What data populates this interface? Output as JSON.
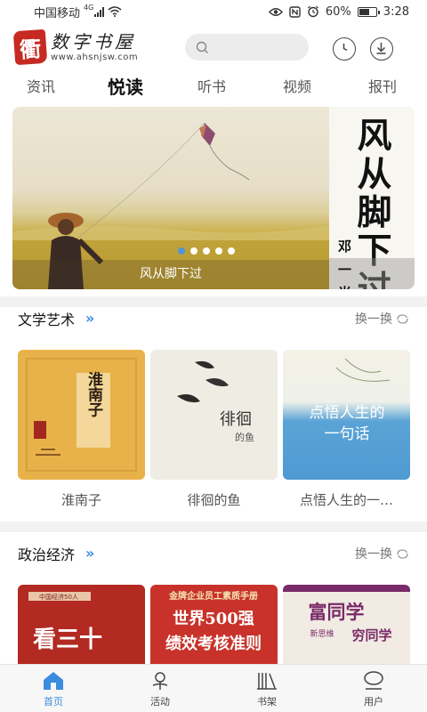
{
  "status_bar": {
    "carrier": "中国移动",
    "network": "4G",
    "battery_percent": "60%",
    "battery_level": 0.6,
    "time": "3:28",
    "icons": [
      "signal-icon",
      "wifi-icon",
      "eye-icon",
      "nfc-icon",
      "alarm-icon",
      "battery-icon"
    ]
  },
  "header": {
    "logo_seal": "衢",
    "logo_name": "数字书屋",
    "logo_url": "www.ahsnjsw.com",
    "search_placeholder": "",
    "icons": [
      "search-icon",
      "history-icon",
      "download-icon"
    ]
  },
  "tabs": [
    {
      "label": "资讯",
      "active": false
    },
    {
      "label": "悦读",
      "active": true
    },
    {
      "label": "听书",
      "active": false
    },
    {
      "label": "视频",
      "active": false
    },
    {
      "label": "报刊",
      "active": false
    }
  ],
  "banner": {
    "caption": "风从脚下过",
    "cover_title": "风从脚下过",
    "cover_author": "邓一光",
    "slide_count": 5,
    "active_slide": 1
  },
  "sections": [
    {
      "title": "文学艺术",
      "refresh_label": "换一换",
      "books": [
        {
          "title": "淮南子",
          "cover_text": "淮南子"
        },
        {
          "title": "徘徊的鱼",
          "cover_text": "徘徊的鱼"
        },
        {
          "title": "点悟人生的一…",
          "cover_text": "点悟人生的一句话"
        }
      ]
    },
    {
      "title": "政治经济",
      "refresh_label": "换一换",
      "books": [
        {
          "title": "",
          "cover_text": "看三十"
        },
        {
          "title": "",
          "cover_text": "世界500强绩效考核准则"
        },
        {
          "title": "",
          "cover_text": "富同学穷同学"
        }
      ],
      "cover_subtitles": [
        "中国经济50人",
        "金牌企业员工素质手册",
        "新思维"
      ]
    }
  ],
  "bottom_nav": [
    {
      "label": "首页",
      "icon": "home-icon",
      "active": true
    },
    {
      "label": "活动",
      "icon": "activity-icon",
      "active": false
    },
    {
      "label": "书架",
      "icon": "bookshelf-icon",
      "active": false
    },
    {
      "label": "用户",
      "icon": "user-icon",
      "active": false
    }
  ],
  "colors": {
    "accent": "#3a8dde",
    "logo_red": "#c62a22",
    "section_gap": "#f2f2f2"
  }
}
